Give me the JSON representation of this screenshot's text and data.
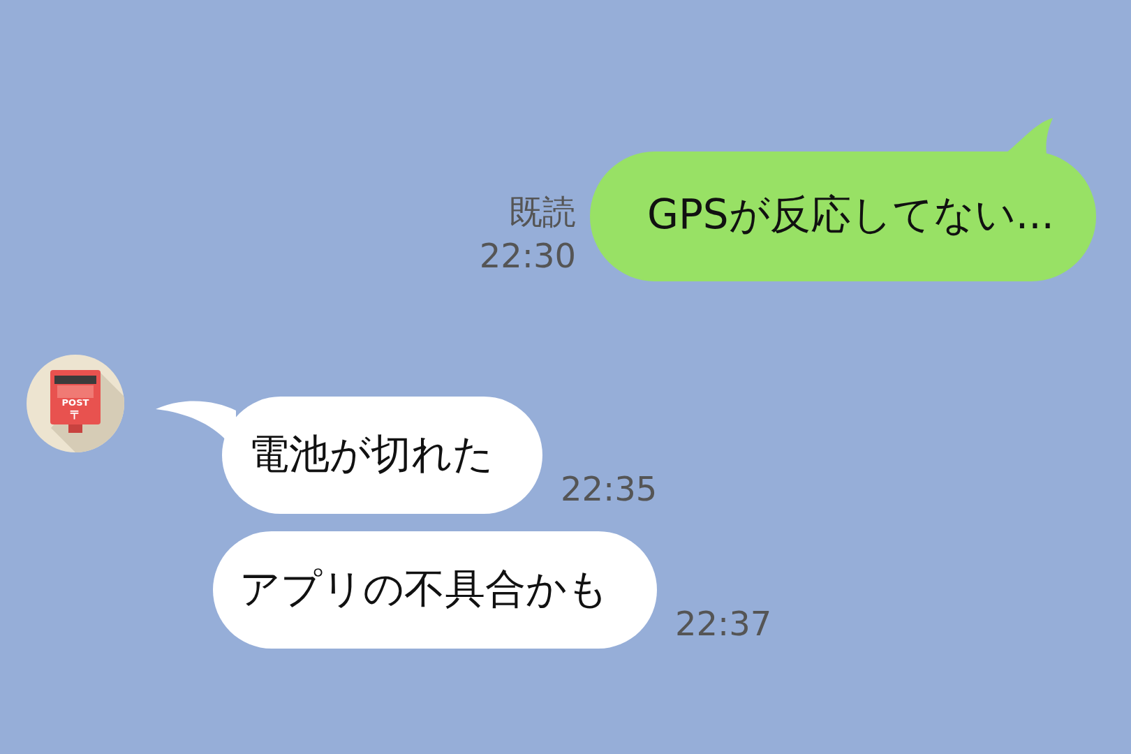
{
  "messages": [
    {
      "kind": "sent",
      "text": "GPSが反応してない...",
      "read": "既読",
      "time": "22:30",
      "tail": true
    },
    {
      "kind": "received",
      "text": "電池が切れた",
      "time": "22:35",
      "tail": true,
      "avatar": {
        "label": "POST",
        "mark": "〒"
      }
    },
    {
      "kind": "received",
      "text": "アプリの不具合かも",
      "time": "22:37",
      "tail": false
    }
  ]
}
